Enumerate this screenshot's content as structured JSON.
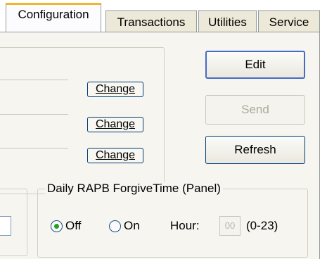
{
  "tabs": [
    {
      "label": "Configuration",
      "active": true
    },
    {
      "label": "Transactions",
      "active": false
    },
    {
      "label": "Utilities",
      "active": false
    },
    {
      "label": "Service",
      "active": false
    }
  ],
  "change_buttons": [
    "Change",
    "Change",
    "Change"
  ],
  "actions": {
    "edit_label": "Edit",
    "send_label": "Send",
    "refresh_label": "Refresh"
  },
  "rapb": {
    "legend": "Daily RAPB ForgiveTime (Panel)",
    "off_label": "Off",
    "on_label": "On",
    "selected": "Off",
    "hour_label": "Hour:",
    "hour_value": "00",
    "range_label": "(0-23)"
  },
  "colors": {
    "active_tab_accent": "#f4b52d",
    "radio_selected": "#21a121",
    "button_border": "#003c74"
  }
}
